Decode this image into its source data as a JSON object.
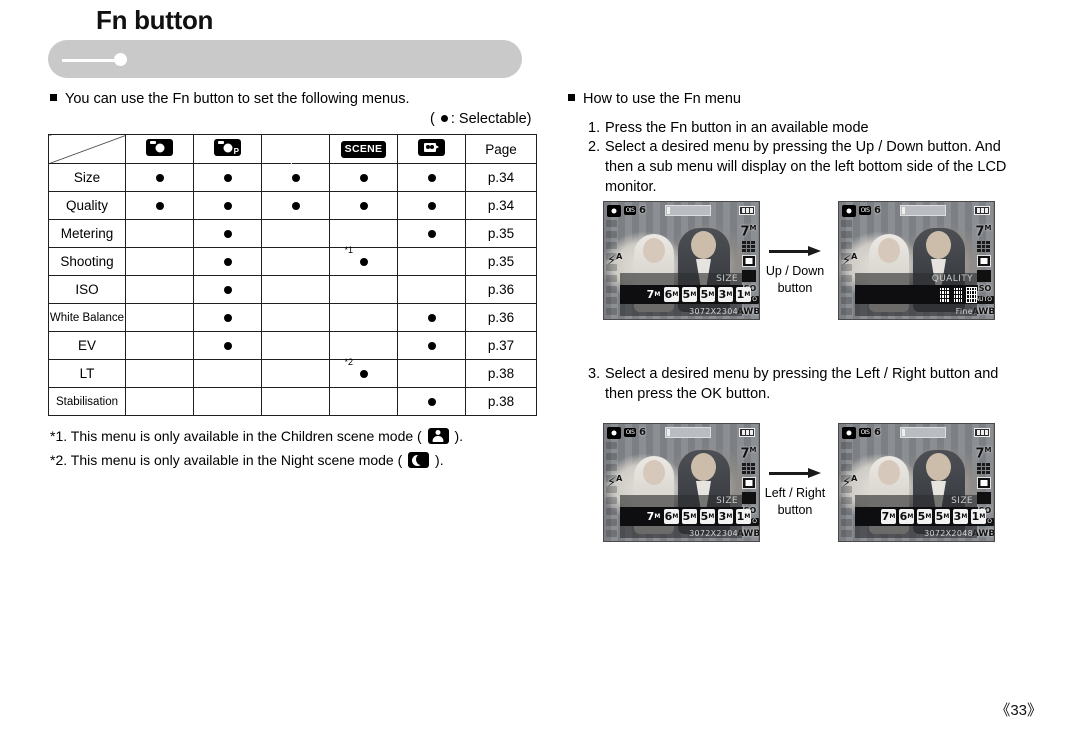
{
  "header": {
    "title": "Fn button"
  },
  "intro": {
    "text": "You can use the Fn button to set the following menus.",
    "selectable_note_open": "( ",
    "selectable_note_text": ": Selectable)"
  },
  "table": {
    "columns": [
      {
        "key": "label",
        "label": "",
        "icon": "diagonal-corner"
      },
      {
        "key": "auto",
        "label": "",
        "icon": "auto-mode-icon"
      },
      {
        "key": "program",
        "label": "",
        "icon": "program-mode-icon"
      },
      {
        "key": "antishake",
        "label": "",
        "icon": "anti-shake-mode-icon"
      },
      {
        "key": "scene",
        "label": "SCENE",
        "icon": "scene-mode-icon"
      },
      {
        "key": "movie",
        "label": "",
        "icon": "movie-mode-icon"
      },
      {
        "key": "page",
        "label": "Page",
        "icon": ""
      }
    ],
    "rows": [
      {
        "label": "Size",
        "small": false,
        "cells": [
          "dot",
          "dot",
          "dot",
          "dot",
          "dot"
        ],
        "notes": [
          "",
          "",
          "",
          "",
          ""
        ],
        "page": "p.34"
      },
      {
        "label": "Quality",
        "small": false,
        "cells": [
          "dot",
          "dot",
          "dot",
          "dot",
          "dot"
        ],
        "notes": [
          "",
          "",
          "",
          "",
          ""
        ],
        "page": "p.34"
      },
      {
        "label": "Metering",
        "small": false,
        "cells": [
          "",
          "dot",
          "",
          "",
          "dot"
        ],
        "notes": [
          "",
          "",
          "",
          "",
          ""
        ],
        "page": "p.35"
      },
      {
        "label": "Shooting",
        "small": false,
        "cells": [
          "",
          "dot",
          "",
          "dot",
          ""
        ],
        "notes": [
          "",
          "",
          "",
          "*1",
          ""
        ],
        "page": "p.35"
      },
      {
        "label": "ISO",
        "small": false,
        "cells": [
          "",
          "dot",
          "",
          "",
          ""
        ],
        "notes": [
          "",
          "",
          "",
          "",
          ""
        ],
        "page": "p.36"
      },
      {
        "label": "White Balance",
        "small": true,
        "cells": [
          "",
          "dot",
          "",
          "",
          "dot"
        ],
        "notes": [
          "",
          "",
          "",
          "",
          ""
        ],
        "page": "p.36"
      },
      {
        "label": "EV",
        "small": false,
        "cells": [
          "",
          "dot",
          "",
          "",
          "dot"
        ],
        "notes": [
          "",
          "",
          "",
          "",
          ""
        ],
        "page": "p.37"
      },
      {
        "label": "LT",
        "small": false,
        "cells": [
          "",
          "",
          "",
          "dot",
          ""
        ],
        "notes": [
          "",
          "",
          "",
          "*2",
          ""
        ],
        "page": "p.38"
      },
      {
        "label": "Stabilisation",
        "small": true,
        "cells": [
          "",
          "",
          "",
          "",
          "dot"
        ],
        "notes": [
          "",
          "",
          "",
          "",
          ""
        ],
        "page": "p.38"
      }
    ]
  },
  "footnotes": [
    {
      "prefix": "*1. This menu is only available in the Children scene mode ( ",
      "icon": "children-scene-icon",
      "suffix": " )."
    },
    {
      "prefix": "*2. This menu is only available in the Night scene mode ( ",
      "icon": "night-scene-icon",
      "suffix": " )."
    }
  ],
  "right": {
    "heading": "How to use the Fn menu",
    "steps": [
      {
        "num": "1.",
        "text": "Press the Fn button in an available mode"
      },
      {
        "num": "2.",
        "text": "Select a desired menu by pressing the Up / Down button. And then a sub menu will display on the left bottom side of the LCD monitor."
      },
      {
        "num": "3.",
        "text": "Select a desired menu by pressing the Left / Right button and then press the OK button."
      }
    ]
  },
  "lcd_examples": [
    {
      "id": "lcd-1",
      "counter": "6",
      "ois_label": "OIS",
      "right_size": "7",
      "right_size_unit": "M",
      "right_iso": "ISO",
      "right_auto": "AUTO",
      "right_awb": "AWB",
      "flash": "A",
      "menu_title": "SIZE",
      "menu_footer": "3072X2304",
      "menu_type": "size",
      "options": [
        {
          "label": "7",
          "unit": "M",
          "selected": false
        },
        {
          "label": "6",
          "unit": "M",
          "selected": true
        },
        {
          "label": "5",
          "unit": "M",
          "selected": true
        },
        {
          "label": "5",
          "unit": "M",
          "selected": true
        },
        {
          "label": "3",
          "unit": "M",
          "selected": true
        },
        {
          "label": "1",
          "unit": "M",
          "selected": true
        }
      ]
    },
    {
      "id": "lcd-2",
      "counter": "6",
      "ois_label": "OIS",
      "right_size": "7",
      "right_size_unit": "M",
      "right_iso": "ISO",
      "right_auto": "AUTO",
      "right_awb": "AWB",
      "flash": "A",
      "menu_title": "QUALITY",
      "menu_footer": "Fine",
      "menu_type": "quality",
      "options": [
        {
          "label": "",
          "unit": "",
          "selected": false
        },
        {
          "label": "",
          "unit": "",
          "selected": false
        },
        {
          "label": "",
          "unit": "",
          "selected": true
        }
      ]
    },
    {
      "id": "lcd-3",
      "counter": "6",
      "ois_label": "OIS",
      "right_size": "7",
      "right_size_unit": "M",
      "right_iso": "ISO",
      "right_auto": "AUTO",
      "right_awb": "AWB",
      "flash": "A",
      "menu_title": "SIZE",
      "menu_footer": "3072X2304",
      "menu_type": "size",
      "options": [
        {
          "label": "7",
          "unit": "M",
          "selected": false
        },
        {
          "label": "6",
          "unit": "M",
          "selected": true
        },
        {
          "label": "5",
          "unit": "M",
          "selected": true
        },
        {
          "label": "5",
          "unit": "M",
          "selected": true
        },
        {
          "label": "3",
          "unit": "M",
          "selected": true
        },
        {
          "label": "1",
          "unit": "M",
          "selected": true
        }
      ]
    },
    {
      "id": "lcd-4",
      "counter": "6",
      "ois_label": "OIS",
      "right_size": "7",
      "right_size_unit": "M",
      "right_iso": "ISO",
      "right_auto": "AUTO",
      "right_awb": "AWB",
      "flash": "A",
      "menu_title": "SIZE",
      "menu_footer": "3072X2048",
      "menu_type": "size",
      "options": [
        {
          "label": "7",
          "unit": "M",
          "selected": true
        },
        {
          "label": "6",
          "unit": "M",
          "selected": true
        },
        {
          "label": "5",
          "unit": "M",
          "selected": true
        },
        {
          "label": "5",
          "unit": "M",
          "selected": true
        },
        {
          "label": "3",
          "unit": "M",
          "selected": true
        },
        {
          "label": "1",
          "unit": "M",
          "selected": true
        }
      ]
    }
  ],
  "arrows": [
    {
      "id": "arrow-updown",
      "line1": "Up / Down",
      "line2": "button"
    },
    {
      "id": "arrow-leftright",
      "line1": "Left / Right",
      "line2": "button"
    }
  ],
  "page_number": "《33》"
}
